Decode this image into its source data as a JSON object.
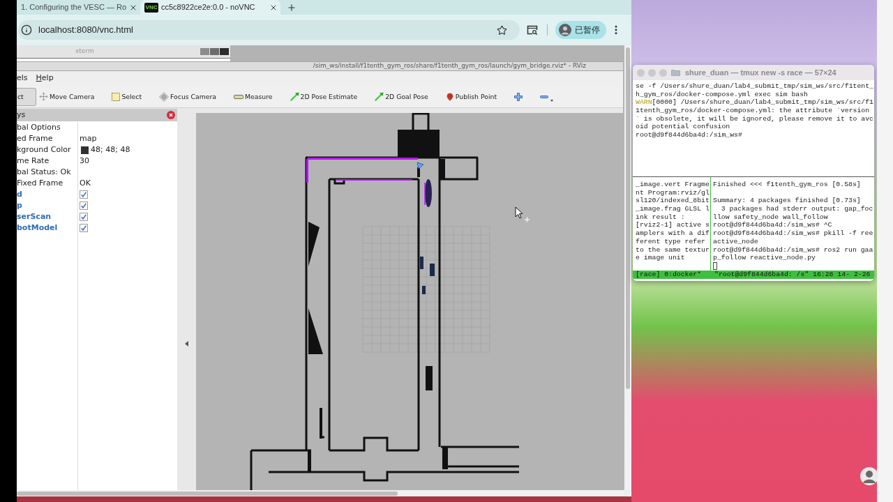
{
  "browser": {
    "tabs": [
      {
        "title": "1. Configuring the VESC — Ro",
        "selected": false
      },
      {
        "title": "cc5c8922ce2e:0.0 - noVNC",
        "selected": true,
        "favicon_text": "VNC"
      }
    ],
    "address": "localhost:8080/vnc.html",
    "profile_label": "已暂停"
  },
  "xterm": {
    "title": "xterm"
  },
  "rviz": {
    "title": "/sim_ws/install/f1tenth_gym_ros/share/f1tenth_gym_ros/launch/gym_bridge.rviz* - RViz",
    "menu": [
      {
        "label": "els",
        "underline_first": false
      },
      {
        "label": "Help",
        "underline_first": true
      }
    ],
    "tools": [
      {
        "kind": "interact",
        "label": "ct",
        "selected": true
      },
      {
        "kind": "move_camera",
        "label": "Move Camera",
        "selected": false
      },
      {
        "kind": "select",
        "label": "Select",
        "selected": false
      },
      {
        "kind": "focus_camera",
        "label": "Focus Camera",
        "selected": false
      },
      {
        "kind": "measure",
        "label": "Measure",
        "selected": false
      },
      {
        "kind": "pose_estimate",
        "label": "2D Pose Estimate",
        "selected": false
      },
      {
        "kind": "goal_pose",
        "label": "2D Goal Pose",
        "selected": false
      },
      {
        "kind": "publish_point",
        "label": "Publish Point",
        "selected": false
      },
      {
        "kind": "add",
        "selected": false
      },
      {
        "kind": "remove",
        "selected": false
      }
    ],
    "displays": {
      "title": "ys",
      "rows": [
        {
          "kind": "property",
          "name": "bal Options"
        },
        {
          "kind": "property",
          "name": "ed Frame",
          "value": "map"
        },
        {
          "kind": "property",
          "name": "kground Color",
          "value": "48; 48; 48",
          "color": "#303030"
        },
        {
          "kind": "property",
          "name": "me Rate",
          "value": "30"
        },
        {
          "kind": "property",
          "name": "bal Status: Ok"
        },
        {
          "kind": "property",
          "name": "Fixed Frame",
          "value": "OK"
        },
        {
          "kind": "display",
          "name": "d",
          "checked": true
        },
        {
          "kind": "display",
          "name": "p",
          "checked": true
        },
        {
          "kind": "display",
          "name": "serScan",
          "checked": true
        },
        {
          "kind": "display",
          "name": "botModel",
          "checked": true
        }
      ]
    }
  },
  "terminal": {
    "title": "shure_duan — tmux new -s race — 57×24",
    "top_lines": [
      {
        "segments": [
          {
            "kind": "plain",
            "text": "se -f /Users/shure_duan/lab4_submit_tmp/sim_ws/src/f1tent_"
          }
        ]
      },
      {
        "segments": [
          {
            "kind": "plain",
            "text": "h_gym_ros/docker-compose.yml exec sim bash"
          }
        ]
      },
      {
        "segments": [
          {
            "kind": "warn",
            "text": "WARN"
          },
          {
            "kind": "plain",
            "text": "[0000] /Users/shure_duan/lab4_submit_tmp/sim_ws/src/f1"
          }
        ]
      },
      {
        "segments": [
          {
            "kind": "plain",
            "text": "1tenth_gym_ros/docker-compose.yml: the attribute `version"
          }
        ]
      },
      {
        "segments": [
          {
            "kind": "plain",
            "text": "` is obsolete, it will be ignored, please remove it to avc"
          }
        ]
      },
      {
        "segments": [
          {
            "kind": "plain",
            "text": "oid potential confusion"
          }
        ]
      },
      {
        "segments": [
          {
            "kind": "plain",
            "text": "root@d9f844d6ba4d:/sim_ws#"
          }
        ]
      }
    ],
    "left_lines": [
      "_image.vert Fragme",
      "nt Program:rviz/gl",
      "sl120/indexed_8bit",
      "_image.frag GLSL l",
      "ink result :",
      "[rviz2-1] active s",
      "amplers with a dif",
      "ferent type refer",
      "to the same textur",
      "e image unit"
    ],
    "right_lines": [
      {
        "kind": "text",
        "text": "Finished <<< f1tenth_gym_ros [0.58s]"
      },
      {
        "kind": "blank"
      },
      {
        "kind": "text",
        "text": "Summary: 4 packages finished [0.73s]"
      },
      {
        "kind": "text",
        "text": "  3 packages had stderr output: gap_foc"
      },
      {
        "kind": "text",
        "text": "llow safety_node wall_follow"
      },
      {
        "kind": "text",
        "text": "root@d9f844d6ba4d:/sim_ws# ^C"
      },
      {
        "kind": "text",
        "text": "root@d9f844d6ba4d:/sim_ws# pkill -f ree"
      },
      {
        "kind": "text",
        "text": "active_node"
      },
      {
        "kind": "text",
        "text": "root@d9f844d6ba4d:/sim_ws# ros2 run gaa"
      },
      {
        "kind": "text",
        "text": "p_follow reactive_node.py"
      }
    ],
    "cursor": true,
    "status_left": "[race] 0:docker*",
    "status_right": "\"root@d9f844d6ba4d: /s\" 16:28 14- 2-26"
  }
}
